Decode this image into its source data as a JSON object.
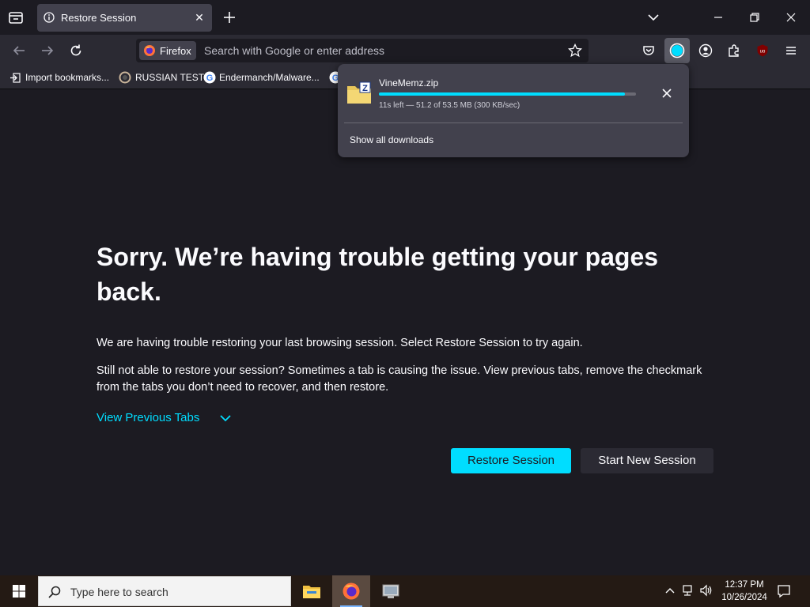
{
  "tab": {
    "title": "Restore Session"
  },
  "urlbar": {
    "identity_label": "Firefox",
    "placeholder": "Search with Google or enter address"
  },
  "bookmarks": [
    {
      "label": "Import bookmarks..."
    },
    {
      "label": "RUSSIAN TEST"
    },
    {
      "label": "Endermanch/Malware..."
    }
  ],
  "download": {
    "filename": "VineMemz.zip",
    "progress_fraction": 0.957,
    "status": "11s left — 51.2 of 53.5 MB (300 KB/sec)",
    "show_all": "Show all downloads"
  },
  "content": {
    "headline": "Sorry. We’re having trouble getting your pages back.",
    "para1": "We are having trouble restoring your last browsing session. Select Restore Session to try again.",
    "para2": "Still not able to restore your session? Sometimes a tab is causing the issue. View previous tabs, remove the checkmark from the tabs you don’t need to recover, and then restore.",
    "view_previous": "View Previous Tabs",
    "restore_button": "Restore Session",
    "new_session_button": "Start New Session"
  },
  "taskbar": {
    "search_placeholder": "Type here to search",
    "time": "12:37 PM",
    "date": "10/26/2024"
  },
  "colors": {
    "accent": "#00ddff",
    "background": "#1c1b22",
    "toolbar": "#2b2a33",
    "panel": "#42414d"
  },
  "icons": [
    "firefox-view-icon",
    "info-icon",
    "close-icon",
    "new-tab-icon",
    "chevron-down-icon",
    "minimize-icon",
    "restore-icon",
    "back-icon",
    "forward-icon",
    "reload-icon",
    "star-icon",
    "pocket-icon",
    "downloads-icon",
    "account-icon",
    "extensions-icon",
    "ublock-icon",
    "menu-icon",
    "zip-folder-icon",
    "windows-start-icon",
    "search-icon",
    "file-explorer-icon",
    "firefox-icon",
    "network-icon",
    "volume-icon",
    "notification-icon"
  ]
}
